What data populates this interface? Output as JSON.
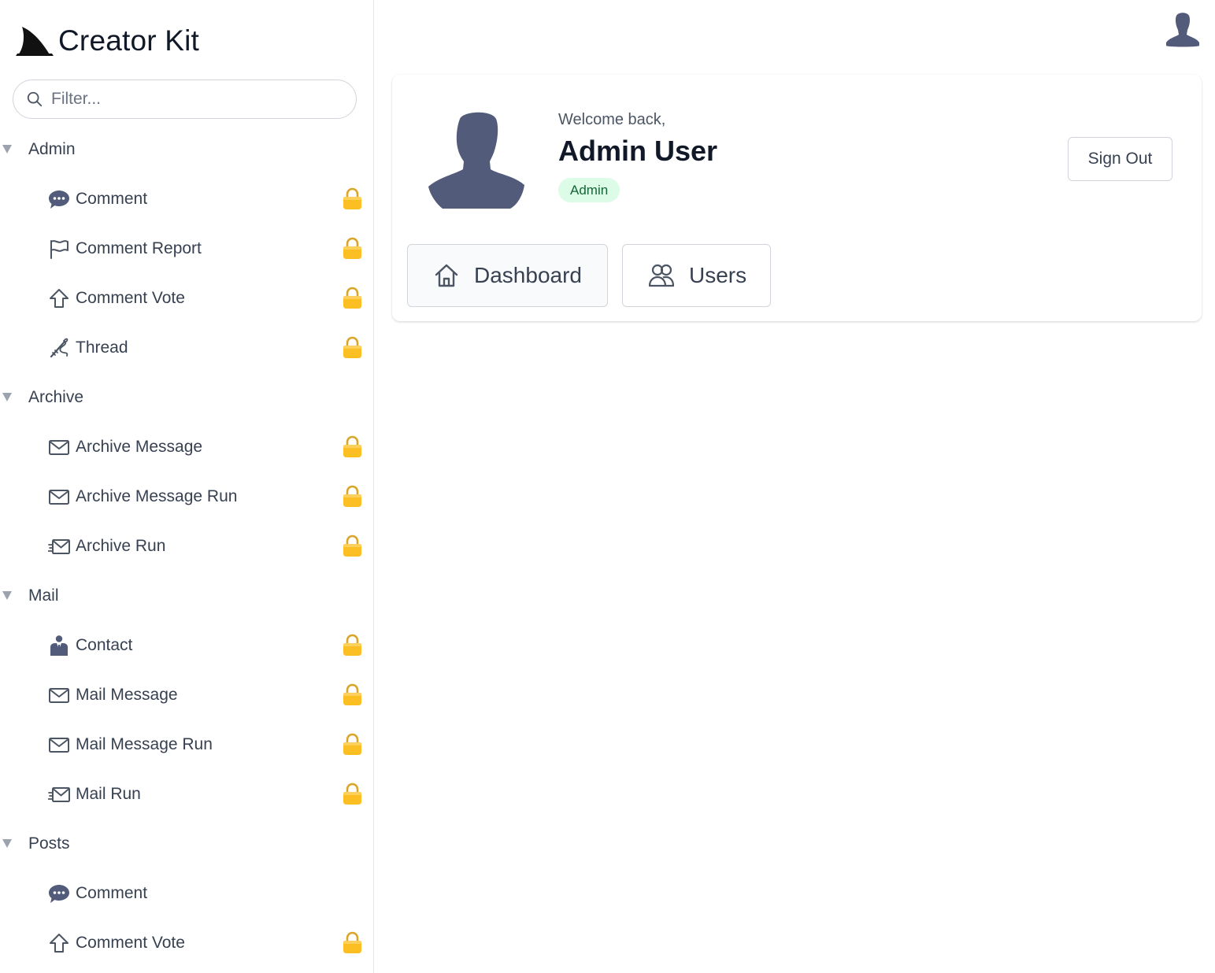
{
  "app": {
    "name": "Creator Kit",
    "logo_icon": "shark-fin-logo-icon"
  },
  "sidebar": {
    "filter_placeholder": "Filter...",
    "groups": [
      {
        "label": "Admin",
        "items": [
          {
            "label": "Comment",
            "icon": "speech-bubble-icon",
            "locked": true
          },
          {
            "label": "Comment Report",
            "icon": "flag-icon",
            "locked": true
          },
          {
            "label": "Comment Vote",
            "icon": "arrow-up-icon",
            "locked": true
          },
          {
            "label": "Thread",
            "icon": "needle-thread-icon",
            "locked": true
          }
        ]
      },
      {
        "label": "Archive",
        "items": [
          {
            "label": "Archive Message",
            "icon": "envelope-icon",
            "locked": true
          },
          {
            "label": "Archive Message Run",
            "icon": "envelope-icon",
            "locked": true
          },
          {
            "label": "Archive Run",
            "icon": "envelope-send-icon",
            "locked": true
          }
        ]
      },
      {
        "label": "Mail",
        "items": [
          {
            "label": "Contact",
            "icon": "person-suit-icon",
            "locked": true
          },
          {
            "label": "Mail Message",
            "icon": "envelope-icon",
            "locked": true
          },
          {
            "label": "Mail Message Run",
            "icon": "envelope-icon",
            "locked": true
          },
          {
            "label": "Mail Run",
            "icon": "envelope-send-icon",
            "locked": true
          }
        ]
      },
      {
        "label": "Posts",
        "items": [
          {
            "label": "Comment",
            "icon": "speech-bubble-icon",
            "locked": false
          },
          {
            "label": "Comment Vote",
            "icon": "arrow-up-icon",
            "locked": true
          }
        ]
      }
    ]
  },
  "profile": {
    "welcome": "Welcome back,",
    "name": "Admin User",
    "role": "Admin",
    "sign_out_label": "Sign Out"
  },
  "tabs": [
    {
      "label": "Dashboard",
      "icon": "home-icon",
      "active": true
    },
    {
      "label": "Users",
      "icon": "users-icon",
      "active": false
    }
  ],
  "colors": {
    "lock": "#fbbf24",
    "avatar": "#525c7a",
    "badge_bg": "#dcfce7",
    "badge_text": "#166534"
  }
}
